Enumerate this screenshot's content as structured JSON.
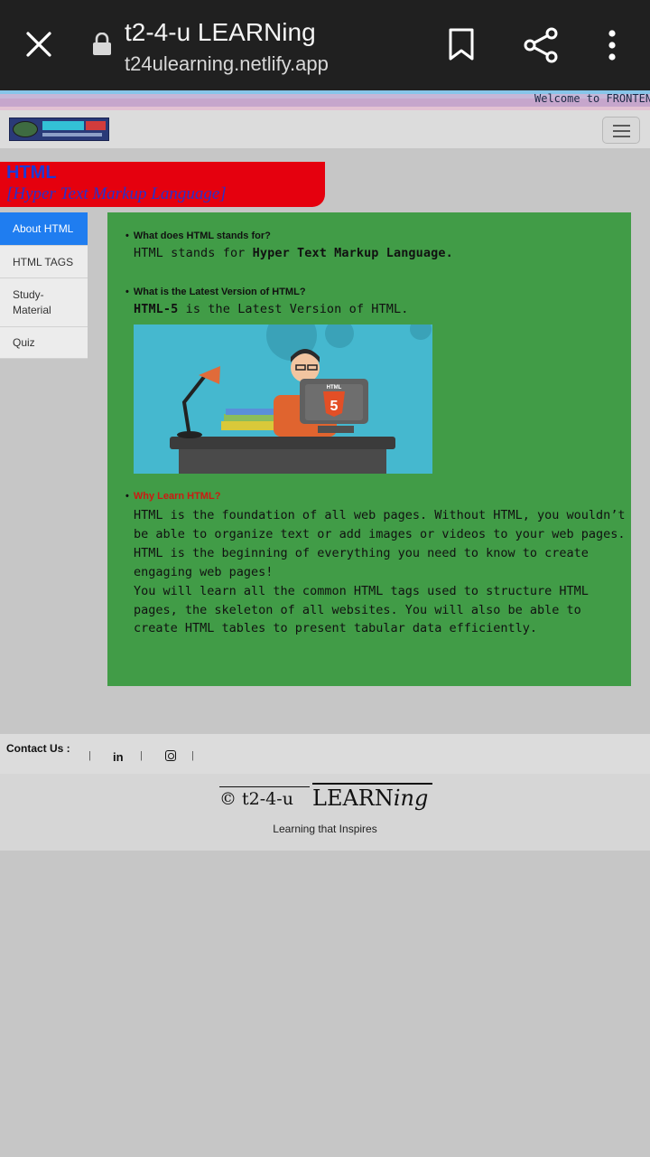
{
  "browser": {
    "title": "t2-4-u LEARNing",
    "url": "t24ulearning.netlify.app"
  },
  "marquee": "Welcome to FRONTEN",
  "header": {
    "heading": "HTML",
    "subheading": "[Hyper Text Markup Language]"
  },
  "sidebar": {
    "items": [
      {
        "label": "About HTML"
      },
      {
        "label": "HTML TAGS"
      },
      {
        "label": "Study-Material"
      },
      {
        "label": "Quiz"
      }
    ]
  },
  "content": {
    "q1": "What does HTML stands for?",
    "a1_prefix": "HTML stands for ",
    "a1_bold": "Hyper Text Markup Language.",
    "q2": "What is the Latest Version of HTML?",
    "a2_bold": "HTML-5",
    "a2_rest": " is the Latest Version of HTML.",
    "image_badge": "HTML",
    "image_number": "5",
    "q3": "Why Learn HTML?",
    "p1": "HTML is the foundation of all web pages. Without HTML, you wouldn’t be able to organize text or add images or videos to your web pages. HTML is the beginning of everything you need to know to create engaging web pages!",
    "p2": "You will learn all the common HTML tags used to structure HTML pages, the skeleton of all websites. You will also be able to create HTML tables to present tabular data efficiently."
  },
  "contact": {
    "label": "Contact Us :",
    "linkedin": "in"
  },
  "footer": {
    "brand_prefix": "© t2-4-u",
    "brand_main": "LEARN",
    "brand_italic": "ing",
    "tagline": "Learning that Inspires"
  },
  "colors": {
    "content_bg": "#419c47",
    "banner_bg": "#e5000e",
    "active_tab": "#1f7df0"
  }
}
